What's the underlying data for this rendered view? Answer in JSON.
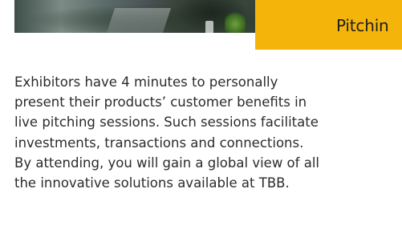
{
  "header": {
    "section_title": "Pitchin"
  },
  "content": {
    "description_lines": [
      "Exhibitors have 4 minutes to personally",
      "present their products’ customer benefits in",
      "live pitching sessions. Such sessions facilitate",
      "investments, transactions and connections.",
      "By attending, you will gain a global view of all",
      "the innovative solutions available at TBB."
    ]
  },
  "colors": {
    "accent": "#f5b40a",
    "text": "#2b2b2b",
    "background": "#ffffff"
  }
}
